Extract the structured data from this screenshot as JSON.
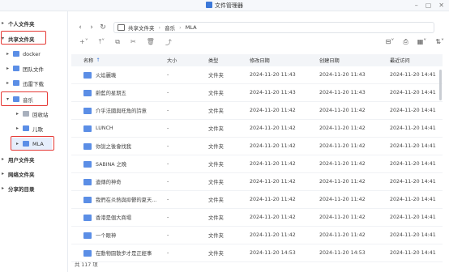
{
  "window": {
    "title": "文件管理器"
  },
  "sidebar": {
    "sections": [
      {
        "label": "个人文件夹"
      },
      {
        "label": "共享文件夹"
      },
      {
        "label": "用户文件夹"
      },
      {
        "label": "网络文件夹"
      },
      {
        "label": "分享的目录"
      }
    ],
    "shared_items": [
      {
        "label": "docker"
      },
      {
        "label": "团队文件"
      },
      {
        "label": "迅雷下载"
      },
      {
        "label": "音乐"
      }
    ],
    "music_children": [
      {
        "label": "回收站"
      },
      {
        "label": "儿歌"
      },
      {
        "label": "MLA"
      }
    ]
  },
  "pathbar": {
    "crumbs": [
      "共享文件夹",
      "音乐",
      "MLA"
    ]
  },
  "table": {
    "headers": {
      "name": "名称",
      "size": "大小",
      "type": "类型",
      "modified": "修改日期",
      "created": "创建日期",
      "accessed": "最近访问"
    },
    "rows": [
      {
        "name": "火焰麗璣",
        "size": "-",
        "type": "文件夹",
        "modified": "2024-11-20 11:43",
        "created": "2024-11-20 11:43",
        "accessed": "2024-11-20 14:41"
      },
      {
        "name": "蔚藍的星期五",
        "size": "-",
        "type": "文件夹",
        "modified": "2024-11-20 11:43",
        "created": "2024-11-20 11:43",
        "accessed": "2024-11-20 14:41"
      },
      {
        "name": "介乎法國與旺角的詩意",
        "size": "-",
        "type": "文件夹",
        "modified": "2024-11-20 11:42",
        "created": "2024-11-20 11:42",
        "accessed": "2024-11-20 14:41"
      },
      {
        "name": "LUNCH",
        "size": "-",
        "type": "文件夹",
        "modified": "2024-11-20 11:42",
        "created": "2024-11-20 11:42",
        "accessed": "2024-11-20 14:41"
      },
      {
        "name": "你說之後會找我",
        "size": "-",
        "type": "文件夹",
        "modified": "2024-11-20 11:42",
        "created": "2024-11-20 11:42",
        "accessed": "2024-11-20 14:41"
      },
      {
        "name": "SABINA 之晚",
        "size": "-",
        "type": "文件夹",
        "modified": "2024-11-20 11:42",
        "created": "2024-11-20 11:42",
        "accessed": "2024-11-20 14:41"
      },
      {
        "name": "遺傳的神奇",
        "size": "-",
        "type": "文件夹",
        "modified": "2024-11-20 11:42",
        "created": "2024-11-20 11:42",
        "accessed": "2024-11-20 14:41"
      },
      {
        "name": "我們在炎熱與抑鬱的夏天...",
        "size": "-",
        "type": "文件夹",
        "modified": "2024-11-20 11:42",
        "created": "2024-11-20 11:42",
        "accessed": "2024-11-20 14:41"
      },
      {
        "name": "香港是個大商場",
        "size": "-",
        "type": "文件夹",
        "modified": "2024-11-20 11:42",
        "created": "2024-11-20 11:42",
        "accessed": "2024-11-20 14:41"
      },
      {
        "name": "一个眼神",
        "size": "-",
        "type": "文件夹",
        "modified": "2024-11-20 11:42",
        "created": "2024-11-20 11:42",
        "accessed": "2024-11-20 14:41"
      },
      {
        "name": "在動物園散步才是正經事",
        "size": "-",
        "type": "文件夹",
        "modified": "2024-11-20 14:53",
        "created": "2024-11-20 14:53",
        "accessed": "2024-11-20 14:41"
      }
    ]
  },
  "status": {
    "count": "共 117 项"
  },
  "colors": {
    "accent": "#3c78d8",
    "highlight_box": "#e53935",
    "selected_bg": "#e6eefc"
  }
}
